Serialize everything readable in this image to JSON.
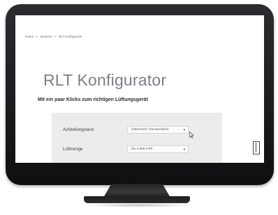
{
  "breadcrumb": {
    "items": [
      "Home",
      "Systeme",
      "RLT-Konfigurator"
    ],
    "separator": ">"
  },
  "page": {
    "title": "RLT Konfigurator",
    "subtitle": "Mit ein paar Klicks zum richtigen Lüftungsgerät"
  },
  "form": {
    "rows": [
      {
        "label": "Aufstellungsland",
        "value": "Österreich / Deutschland"
      },
      {
        "label": "Luftmenge",
        "value": "bis 2.800 m³/h"
      }
    ]
  },
  "icons": {
    "select_caret": "caret-down-icon",
    "cursor": "mouse-pointer-icon",
    "right_edge": "door-icon"
  },
  "colors": {
    "bezel": "#111214",
    "panel": "#ececec",
    "title": "#7b7f86"
  }
}
